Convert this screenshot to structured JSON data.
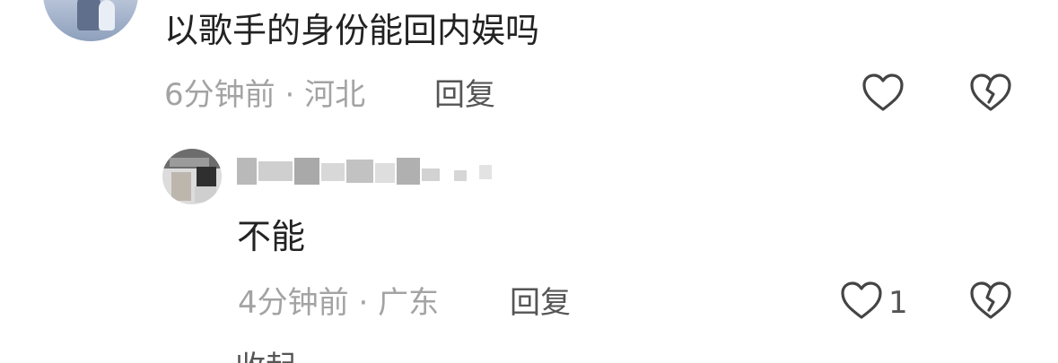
{
  "comment": {
    "text": "以歌手的身份能回内娱吗",
    "time": "6分钟前",
    "separator": "·",
    "location": "河北",
    "reply_label": "回复",
    "like_icon": "heart-outline-icon",
    "dislike_icon": "broken-heart-icon"
  },
  "reply": {
    "text": "不能",
    "time": "4分钟前",
    "separator": "·",
    "location": "广东",
    "reply_label": "回复",
    "like_count": "1",
    "like_icon": "heart-outline-icon",
    "dislike_icon": "broken-heart-icon"
  },
  "footer": {
    "collapse_label": "收起"
  },
  "colors": {
    "text_primary": "#222222",
    "text_meta": "#a3a3a3",
    "text_action": "#555555",
    "icon_stroke": "#444444",
    "background": "#ffffff"
  }
}
